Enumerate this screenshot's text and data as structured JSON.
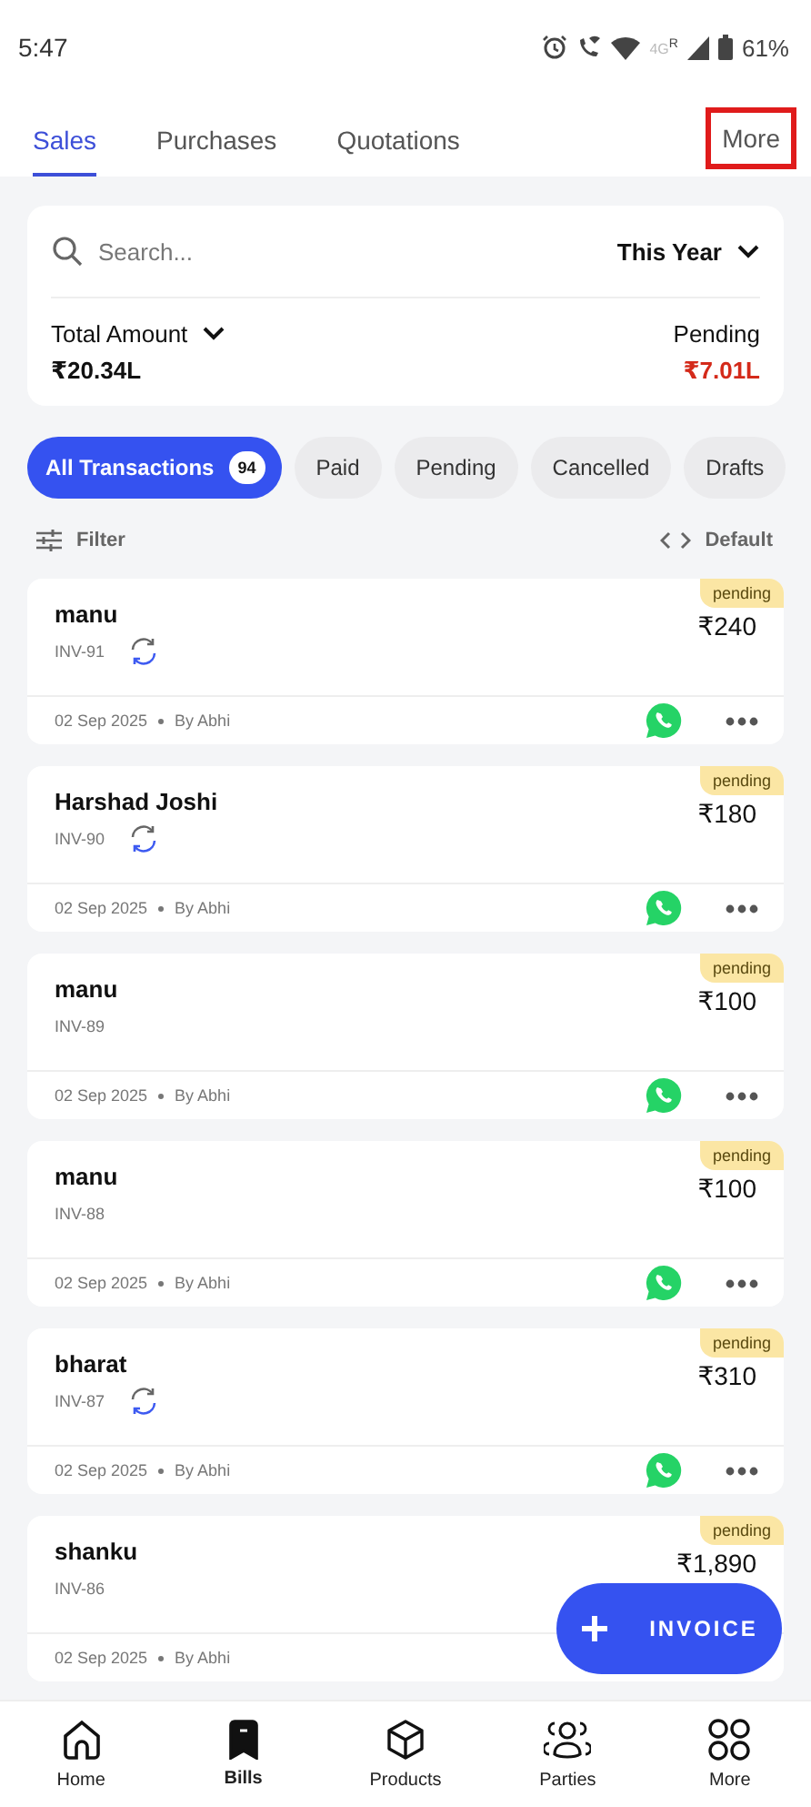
{
  "status_bar": {
    "time": "5:47",
    "battery": "61%",
    "network": "4G",
    "roaming": "R"
  },
  "tabs": [
    {
      "label": "Sales",
      "selected": true
    },
    {
      "label": "Purchases",
      "selected": false
    },
    {
      "label": "Quotations",
      "selected": false
    }
  ],
  "more_button": {
    "label": "More",
    "highlighted": true
  },
  "summary": {
    "search": {
      "placeholder": "Search..."
    },
    "period": "This Year",
    "total_label": "Total Amount",
    "total": "₹20.34L",
    "pending_label": "Pending",
    "pending": "₹7.01L"
  },
  "chips": [
    {
      "label": "All Transactions",
      "count": "94",
      "selected": true
    },
    {
      "label": "Paid",
      "selected": false
    },
    {
      "label": "Pending",
      "selected": false
    },
    {
      "label": "Cancelled",
      "selected": false
    },
    {
      "label": "Drafts",
      "selected": false
    }
  ],
  "filter": {
    "label": "Filter",
    "sort": "Default"
  },
  "invoices": [
    {
      "name": "manu",
      "number": "INV-91",
      "recurring": true,
      "status": "pending",
      "amount": "₹240",
      "date": "02 Sep 2025",
      "by": "By Abhi",
      "actions": true
    },
    {
      "name": "Harshad Joshi",
      "number": "INV-90",
      "recurring": true,
      "status": "pending",
      "amount": "₹180",
      "date": "02 Sep 2025",
      "by": "By Abhi",
      "actions": true
    },
    {
      "name": "manu",
      "number": "INV-89",
      "recurring": false,
      "status": "pending",
      "amount": "₹100",
      "date": "02 Sep 2025",
      "by": "By Abhi",
      "actions": true
    },
    {
      "name": "manu",
      "number": "INV-88",
      "recurring": false,
      "status": "pending",
      "amount": "₹100",
      "date": "02 Sep 2025",
      "by": "By Abhi",
      "actions": true
    },
    {
      "name": "bharat",
      "number": "INV-87",
      "recurring": true,
      "status": "pending",
      "amount": "₹310",
      "date": "02 Sep 2025",
      "by": "By Abhi",
      "actions": true
    },
    {
      "name": "shanku",
      "number": "INV-86",
      "recurring": false,
      "status": "pending",
      "amount": "₹1,890",
      "date": "02 Sep 2025",
      "by": "By Abhi",
      "actions": false
    }
  ],
  "fab": {
    "label": "INVOICE"
  },
  "bottom_nav": [
    {
      "label": "Home",
      "kind": "home",
      "selected": false
    },
    {
      "label": "Bills",
      "kind": "bills",
      "selected": true
    },
    {
      "label": "Products",
      "kind": "products",
      "selected": false
    },
    {
      "label": "Parties",
      "kind": "parties",
      "selected": false
    },
    {
      "label": "More",
      "kind": "more",
      "selected": false
    }
  ]
}
